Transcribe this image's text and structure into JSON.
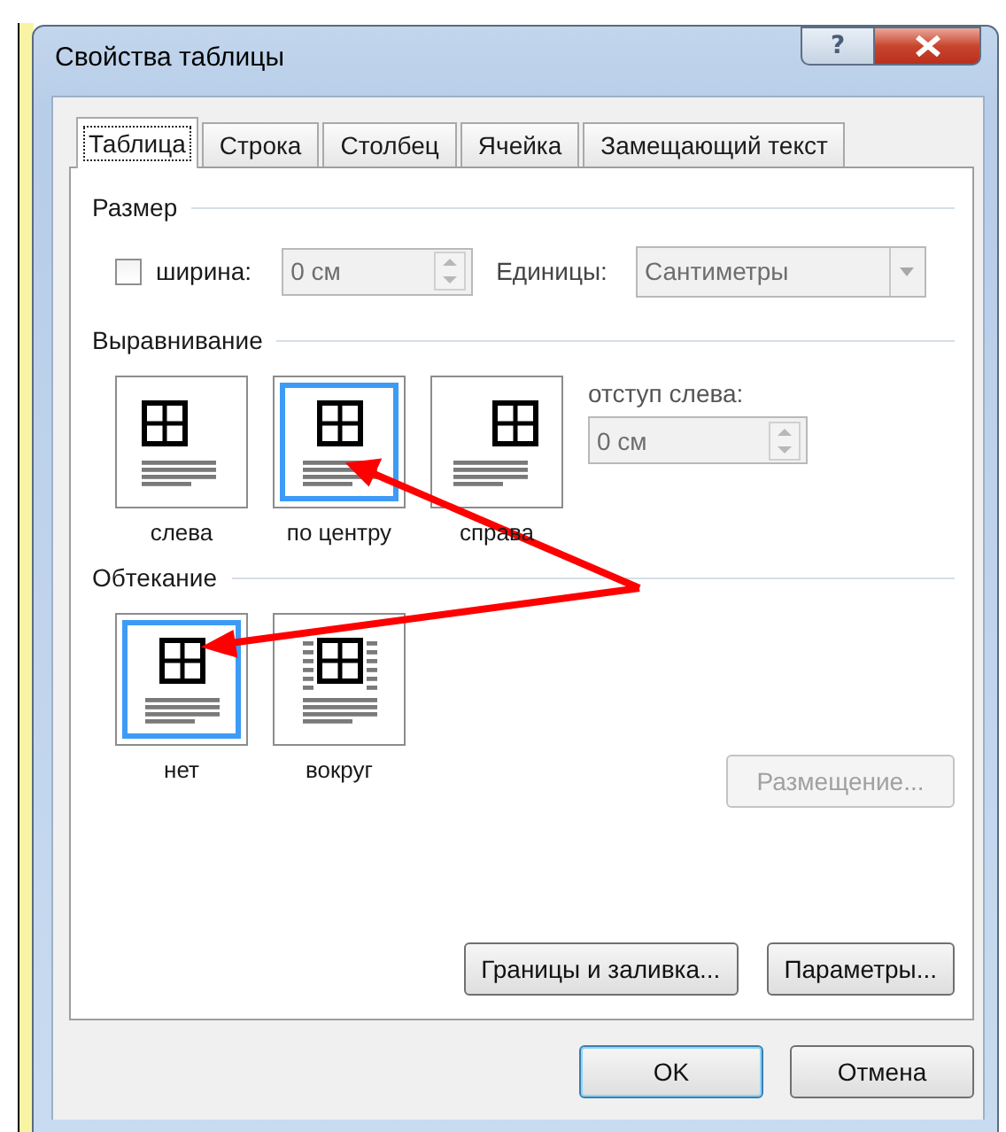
{
  "window": {
    "title": "Свойства таблицы",
    "help_label": "?"
  },
  "tabs": [
    {
      "label": "Таблица",
      "selected": true,
      "focused": true
    },
    {
      "label": "Строка",
      "selected": false,
      "focused": false
    },
    {
      "label": "Столбец",
      "selected": false,
      "focused": false
    },
    {
      "label": "Ячейка",
      "selected": false,
      "focused": false
    },
    {
      "label": "Замещающий текст",
      "selected": false,
      "focused": false
    }
  ],
  "size": {
    "title": "Размер",
    "width_checkbox": {
      "label": "ширина:",
      "checked": false
    },
    "width_field": {
      "value": "0 см",
      "disabled": true
    },
    "units_label": "Единицы:",
    "units_select": {
      "value": "Сантиметры",
      "disabled": true
    }
  },
  "alignment": {
    "title": "Выравнивание",
    "options": [
      {
        "label": "слева",
        "selected": false,
        "kind": "left"
      },
      {
        "label": "по центру",
        "selected": true,
        "kind": "center"
      },
      {
        "label": "справа",
        "selected": false,
        "kind": "right"
      }
    ],
    "indent_label": "отступ слева:",
    "indent_field": {
      "value": "0 см",
      "disabled": true
    }
  },
  "wrapping": {
    "title": "Обтекание",
    "options": [
      {
        "label": "нет",
        "selected": true,
        "kind": "none"
      },
      {
        "label": "вокруг",
        "selected": false,
        "kind": "around"
      }
    ],
    "positioning_button": {
      "label": "Размещение...",
      "disabled": true
    }
  },
  "panel_buttons": [
    {
      "label": "Границы и заливка..."
    },
    {
      "label": "Параметры..."
    }
  ],
  "dialog_buttons": [
    {
      "label": "OK",
      "default": true
    },
    {
      "label": "Отмена",
      "default": false
    }
  ]
}
